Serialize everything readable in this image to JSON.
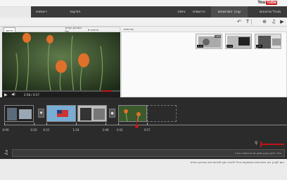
{
  "brand": {
    "name_left": "You",
    "name_right": "Tube"
  },
  "nav": {
    "tabs": [
      {
        "label": "מנהל סרטונים"
      },
      {
        "label": "עורך הסרטונים"
      },
      {
        "label": "הרשמות"
      },
      {
        "label": "ניתוח"
      },
      {
        "label": "הודעות"
      },
      {
        "label": "רשימות"
      }
    ]
  },
  "toolbar": {
    "icons": [
      "camera-icon",
      "music-icon",
      "transition-icon",
      "text-icon",
      "undo-icon"
    ],
    "glyphs": [
      "▶",
      "♫",
      "⊕",
      "T",
      "↶"
    ]
  },
  "preview": {
    "small_button": "פרסם",
    "dropdown": "הסרטון הערוך שלי",
    "dropdown_prefix": "פרטים",
    "time_current": "2:58",
    "time_total": "4:57"
  },
  "browser": {
    "label": "סרטונים",
    "thumbs": [
      {
        "duration": "1:57",
        "caption": ""
      },
      {
        "duration": "0:34",
        "caption": ""
      },
      {
        "duration": "0:34",
        "caption": "Cats"
      }
    ]
  },
  "timeline": {
    "ticks": [
      "0:00",
      "0:20",
      "0:31",
      "1:24",
      "2:46",
      "3:42",
      "4:57"
    ],
    "audio_placeholder": "גרור לכאן קטע שמע מהכרטיסייה אודיו"
  },
  "footer": {
    "text": "ניתן לערוך את הסרטונים באמצעות הכלי ולאחר מכן לפרסם את הסרטון החדש"
  }
}
